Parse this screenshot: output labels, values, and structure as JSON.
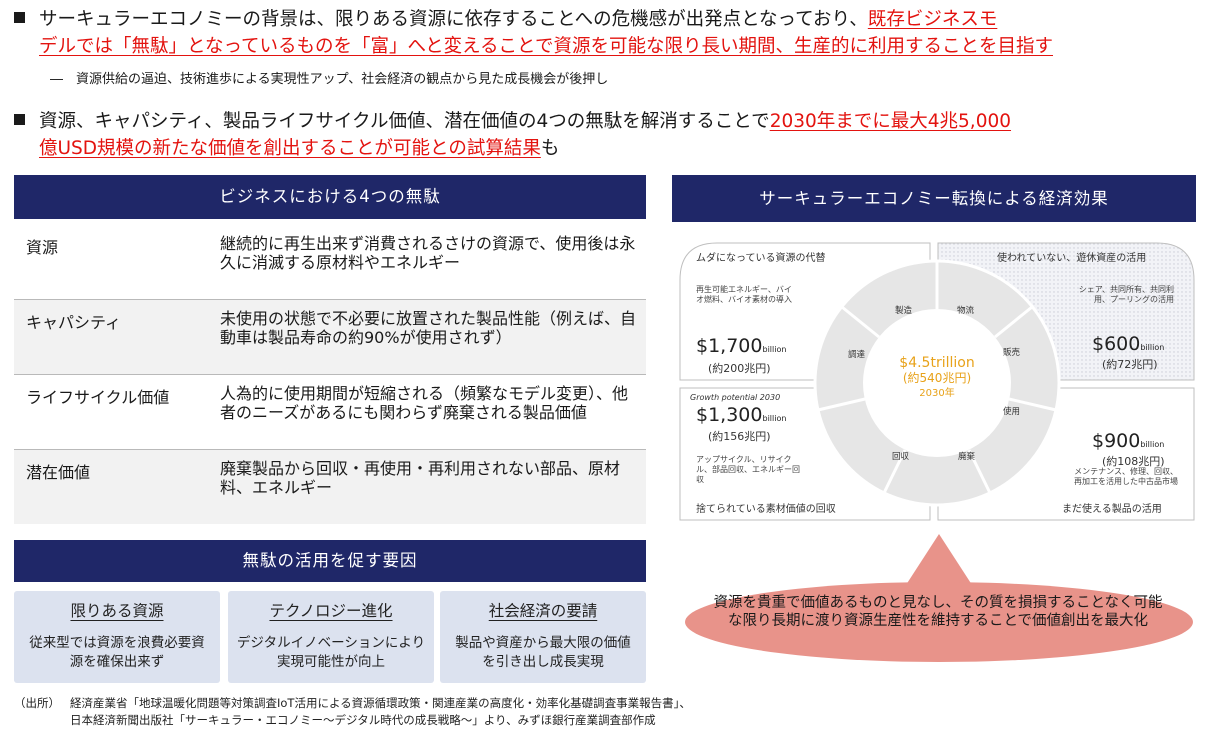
{
  "bullet1": {
    "line1_plain": "サーキュラーエコノミーの背景は、限りある資源に依存することへの危機感が出発点となっており、",
    "line1_red": "既存ビジネスモ",
    "line2_red": "デルでは「無駄」となっているものを「富」へと変えることで資源を可能な限り長い期間、生産的に利用することを目指す"
  },
  "sub1": "―　資源供給の逼迫、技術進歩による実現性アップ、社会経済の観点から見た成長機会が後押し",
  "bullet2": {
    "line1_plain": "資源、キャパシティ、製品ライフサイクル価値、潜在価値の4つの無駄を解消することで",
    "line1_red": "2030年までに最大4兆5,000",
    "line2_red": "億USD規模の新たな価値を創出することが可能との試算結果",
    "line2_plain": "も"
  },
  "left_header": "ビジネスにおける4つの無駄",
  "waste_rows": [
    {
      "label": "資源",
      "desc": "継続的に再生出来ず消費されるさけの資源で、使用後は永久に消滅する原材料やエネルギー"
    },
    {
      "label": "キャパシティ",
      "desc": "未使用の状態で不必要に放置された製品性能（例えば、自動車は製品寿命の約90%が使用されず）"
    },
    {
      "label": "ライフサイクル価値",
      "desc": "人為的に使用期間が短縮される（頻繁なモデル変更）、他者のニーズがあるにも関わらず廃棄される製品価値"
    },
    {
      "label": "潜在価値",
      "desc": "廃棄製品から回収・再使用・再利用されない部品、原材料、エネルギー"
    }
  ],
  "factors_header": "無駄の活用を促す要因",
  "factors": [
    {
      "title": "限りある資源",
      "desc": "従来型では資源を浪費必要資源を確保出来ず"
    },
    {
      "title": "テクノロジー進化",
      "desc": "デジタルイノベーションにより実現可能性が向上"
    },
    {
      "title": "社会経済の要請",
      "desc": "製品や資産から最大限の価値を引き出し成長実現"
    }
  ],
  "right_header": "サーキュラーエコノミー転換による経済効果",
  "quadrants": {
    "tl": {
      "title": "ムダになっている資源の代替",
      "note": "再生可能エネルギー、バイオ燃料、バイオ素材の導入",
      "amount": "$1,700",
      "unit": "billion",
      "yen": "(約200兆円)"
    },
    "tr": {
      "title": "使われていない、遊休資産の活用",
      "note": "シェア、共同所有、共同利用、プーリングの活用",
      "amount": "$600",
      "unit": "billion",
      "yen": "(約72兆円)"
    },
    "bl": {
      "title": "捨てられている素材価値の回収",
      "label": "Growth potential 2030",
      "note": "アップサイクル、リサイクル、部品回収、エネルギー回収",
      "amount": "$1,300",
      "unit": "billion",
      "yen": "(約156兆円)"
    },
    "br": {
      "title": "まだ使える製品の活用",
      "note": "メンテナンス、修理、回収、再加工を活用した中古品市場",
      "amount": "$900",
      "unit": "billion",
      "yen": "(約108兆円)"
    }
  },
  "center": {
    "value": "$4.5trillion",
    "yen": "(約540兆円)",
    "year": "2030年"
  },
  "segments": [
    "製造",
    "物流",
    "販売",
    "使用",
    "廃棄",
    "回収",
    "調達"
  ],
  "callout": "資源を貴重で価値あるものと見なし、その質を損損することなく可能な限り長期に渡り資源生産性を維持することで価値創出を最大化",
  "source": {
    "label": "（出所）",
    "line1": "経済産業省「地球温暖化問題等対策調査IoT活用による資源循環政策・関連産業の高度化・効率化基礎調査事業報告書」、",
    "line2": "日本経済新聞出版社「サーキュラー・エコノミー～デジタル時代の成長戦略～」より、みずほ銀行産業調査部作成"
  },
  "colors": {
    "navy": "#1f2768",
    "red": "#e3130f",
    "factor_bg": "#dce2ef",
    "callout": "#e8938a",
    "accent_gold": "#e8a21a"
  }
}
